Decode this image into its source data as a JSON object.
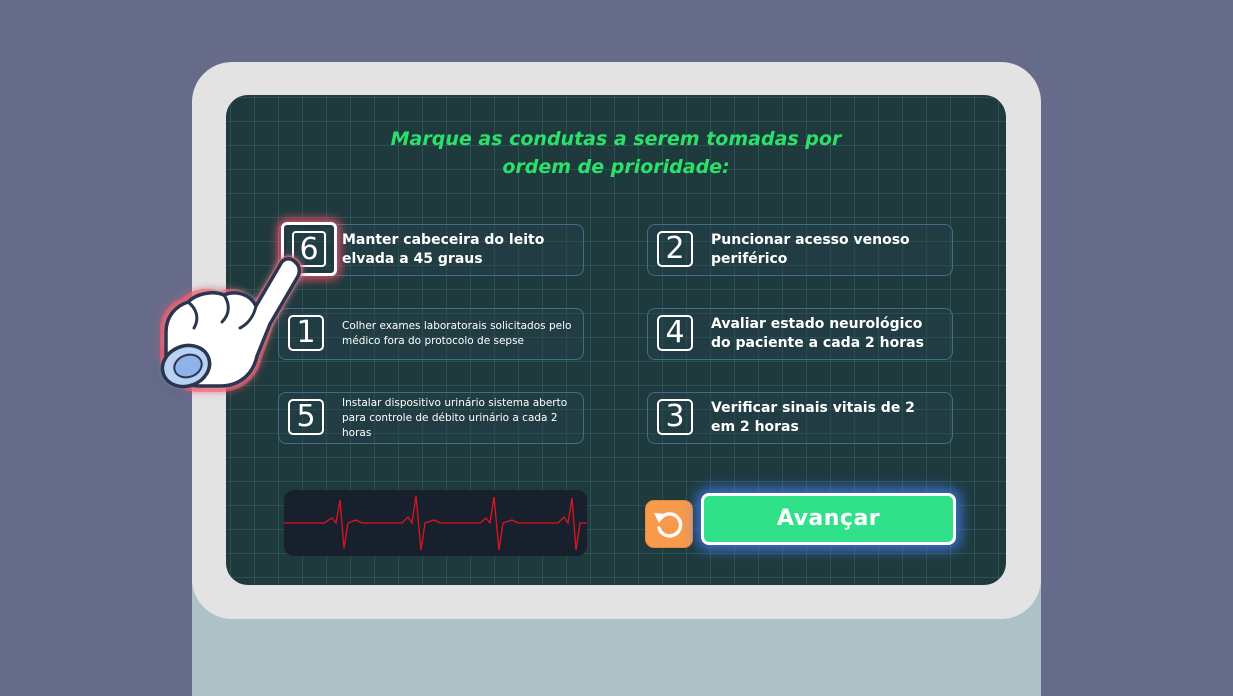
{
  "instruction": {
    "line1": "Marque as condutas a serem tomadas por",
    "line2": "ordem de prioridade:"
  },
  "options": [
    {
      "number": "6",
      "text": "Manter cabeceira do leito elvada a 45 graus",
      "selected": true
    },
    {
      "number": "2",
      "text": "Puncionar acesso venoso periférico"
    },
    {
      "number": "1",
      "text": "Colher exames laboratorais solicitados pelo médico fora do protocolo de sepse"
    },
    {
      "number": "4",
      "text": "Avaliar estado neurológico do paciente a cada 2 horas"
    },
    {
      "number": "5",
      "text": "Instalar dispositivo urinário sistema aberto para controle de débito urinário a cada 2 horas"
    },
    {
      "number": "3",
      "text": "Verificar sinais vitais de 2 em 2 horas"
    }
  ],
  "buttons": {
    "advance_label": "Avançar",
    "reset_icon": "rotate-ccw-icon"
  },
  "colors": {
    "title": "#2de06a",
    "advance": "#30e18a",
    "reset": "#f79a4c",
    "ecg_line": "#e0141e",
    "screen": "#1e3a3d"
  }
}
